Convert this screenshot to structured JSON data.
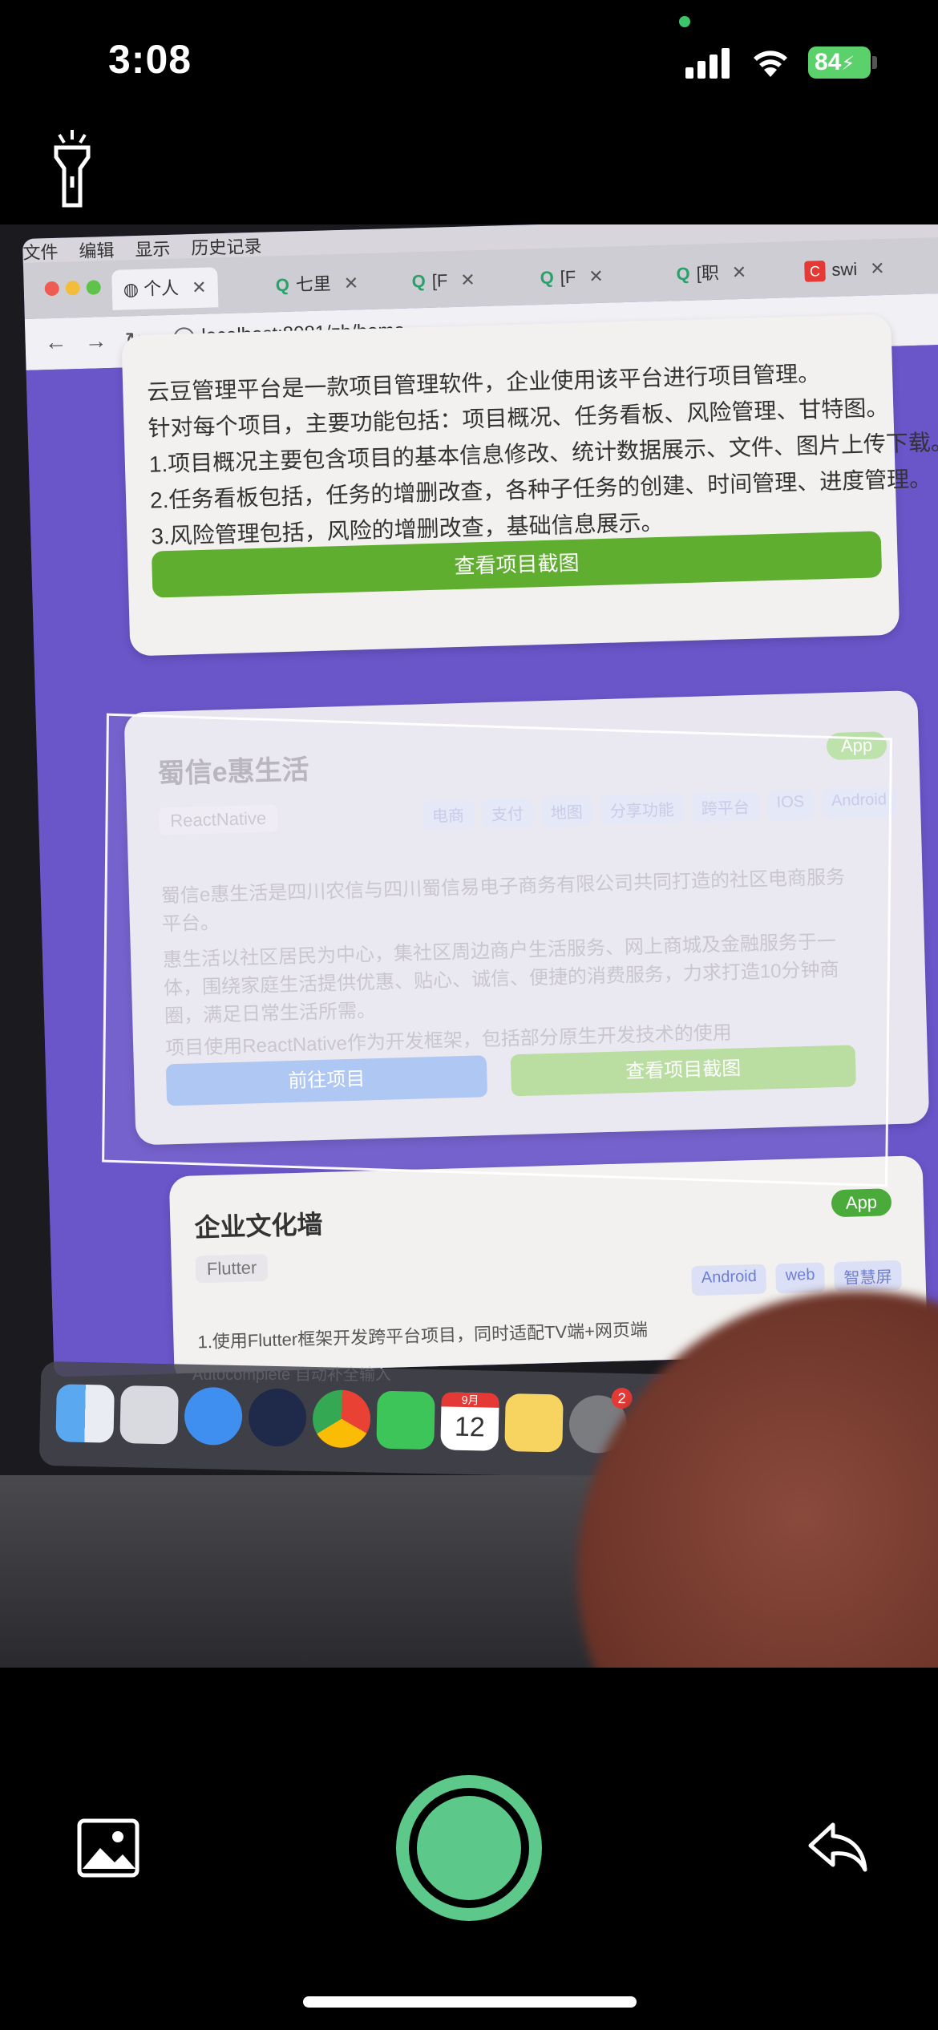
{
  "status_bar": {
    "time": "3:08",
    "battery": "84"
  },
  "browser": {
    "menu": [
      "文件",
      "编辑",
      "显示",
      "历史记录"
    ],
    "tabs": [
      {
        "icon": "globe",
        "label": "个人"
      },
      {
        "icon": "q",
        "label": "七里"
      },
      {
        "icon": "q",
        "label": "[F"
      },
      {
        "icon": "q",
        "label": "[F"
      },
      {
        "icon": "q",
        "label": "[职"
      },
      {
        "icon": "c",
        "label": "swi"
      }
    ],
    "url": "localhost:8081/zh/home"
  },
  "card1": {
    "lines": [
      "云豆管理平台是一款项目管理软件，企业使用该平台进行项目管理。",
      "针对每个项目，主要功能包括：项目概况、任务看板、风险管理、甘特图。",
      "1.项目概况主要包含项目的基本信息修改、统计数据展示、文件、图片上传下载。",
      "2.任务看板包括，任务的增删改查，各种子任务的创建、时间管理、进度管理。",
      "3.风险管理包括，风险的增删改查，基础信息展示。"
    ],
    "button": "查看项目截图"
  },
  "card2": {
    "title": "蜀信e惠生活",
    "badge": "App",
    "framework": "ReactNative",
    "tags": [
      "电商",
      "支付",
      "地图",
      "分享功能",
      "跨平台",
      "IOS",
      "Android"
    ],
    "desc": [
      "蜀信e惠生活是四川农信与四川蜀信易电子商务有限公司共同打造的社区电商服务",
      "平台。",
      "惠生活以社区居民为中心，集社区周边商户生活服务、网上商城及金融服务于一",
      "体，围绕家庭生活提供优惠、贴心、诚信、便捷的消费服务，力求打造10分钟商",
      "圈，满足日常生活所需。",
      "项目使用ReactNative作为开发框架，包括部分原生开发技术的使用"
    ],
    "btn_left": "前往项目",
    "btn_right": "查看项目截图"
  },
  "card3": {
    "title": "企业文化墙",
    "badge": "App",
    "framework": "Flutter",
    "tags": [
      "Android",
      "web",
      "智慧屏"
    ],
    "desc": "1.使用Flutter框架开发跨平台项目，同时适配TV端+网页端"
  },
  "dock": {
    "tooltip": "Autocomplete 自动补全输入",
    "calendar_month": "9月",
    "calendar_day": "12",
    "settings_badge": "2"
  }
}
